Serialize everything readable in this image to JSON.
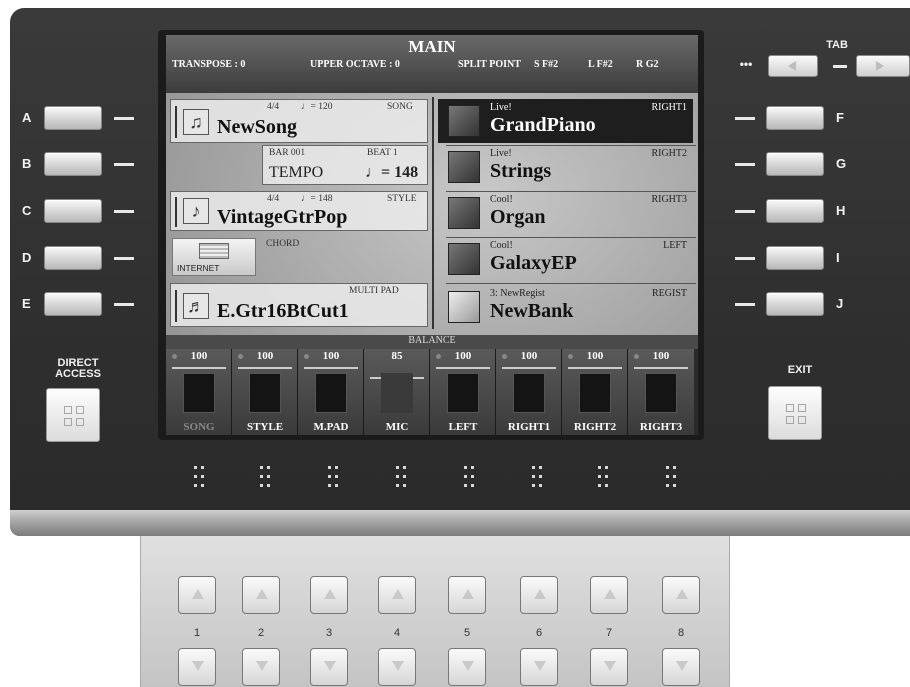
{
  "screen": {
    "title": "MAIN",
    "transpose": "TRANSPOSE : 0",
    "upper_octave": "UPPER OCTAVE : 0",
    "split_point_label": "SPLIT POINT",
    "split_s": "S F#2",
    "split_l": "L F#2",
    "split_r": "R G2"
  },
  "song": {
    "time_sig": "4/4",
    "tempo_text": "♩= 120",
    "tag": "SONG",
    "name": "NewSong",
    "bar_label": "BAR  001",
    "beat_label": "BEAT   1",
    "tempo_label": "TEMPO",
    "tempo_value": "♩= 148"
  },
  "style": {
    "time_sig": "4/4",
    "tempo_text": "♩= 148",
    "tag": "STYLE",
    "name": "VintageGtrPop",
    "chord_label": "CHORD",
    "internet_label": "INTERNET"
  },
  "multipad": {
    "tag": "MULTI PAD",
    "name": "E.Gtr16BtCut1"
  },
  "parts": [
    {
      "prefix": "Live!",
      "part": "RIGHT1",
      "voice": "GrandPiano"
    },
    {
      "prefix": "Live!",
      "part": "RIGHT2",
      "voice": "Strings"
    },
    {
      "prefix": "Cool!",
      "part": "RIGHT3",
      "voice": "Organ"
    },
    {
      "prefix": "Cool!",
      "part": "LEFT",
      "voice": "GalaxyEP"
    },
    {
      "prefix": "3: NewRegist",
      "part": "REGIST",
      "voice": "NewBank"
    }
  ],
  "balance": {
    "label": "BALANCE",
    "channels": [
      {
        "name": "SONG",
        "value": "100"
      },
      {
        "name": "STYLE",
        "value": "100"
      },
      {
        "name": "M.PAD",
        "value": "100"
      },
      {
        "name": "MIC",
        "value": "85"
      },
      {
        "name": "LEFT",
        "value": "100"
      },
      {
        "name": "RIGHT1",
        "value": "100"
      },
      {
        "name": "RIGHT2",
        "value": "100"
      },
      {
        "name": "RIGHT3",
        "value": "100"
      }
    ]
  },
  "left_buttons": [
    "A",
    "B",
    "C",
    "D",
    "E"
  ],
  "right_buttons": [
    "F",
    "G",
    "H",
    "I",
    "J"
  ],
  "direct_access_label": "DIRECT ACCESS",
  "exit_label": "EXIT",
  "tab_label": "TAB",
  "tab_dots": "•••",
  "number_buttons": [
    "1",
    "2",
    "3",
    "4",
    "5",
    "6",
    "7",
    "8"
  ]
}
